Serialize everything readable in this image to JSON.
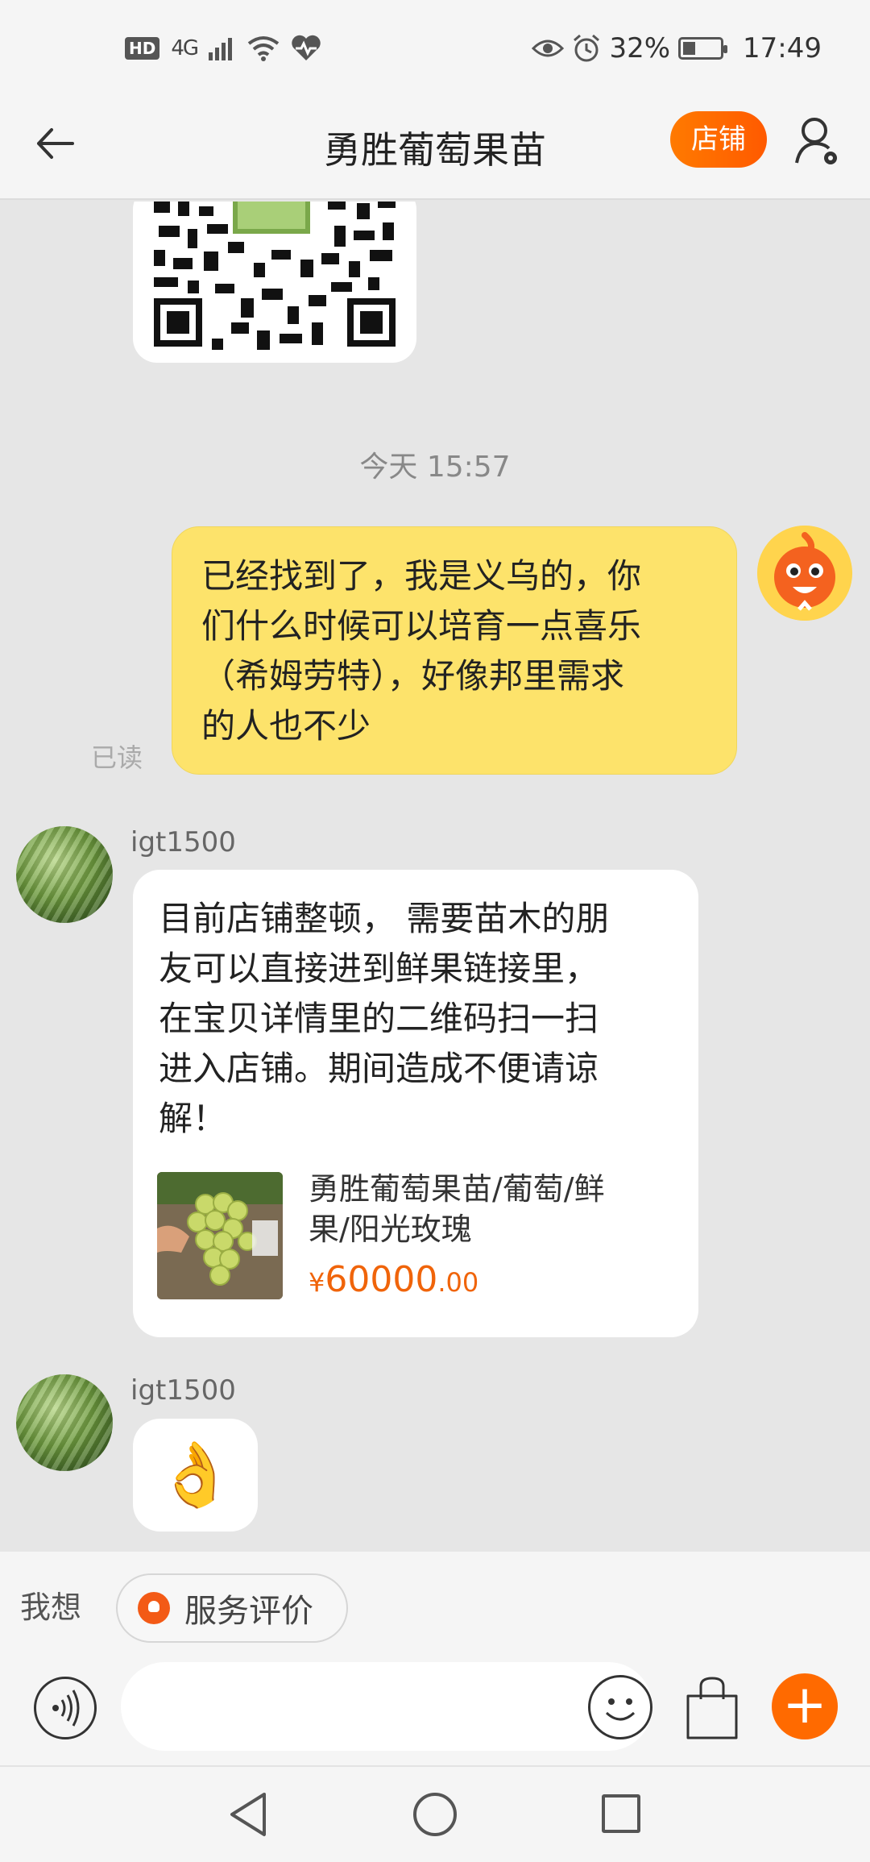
{
  "status_bar": {
    "left_badges": [
      "HD",
      "4G",
      "wifi-icon",
      "health-icon"
    ],
    "hd": "HD",
    "network": "4G",
    "battery": "32%",
    "battery_level": 0.32,
    "time": "17:49"
  },
  "header": {
    "title": "勇胜葡萄果苗",
    "shop_button": "店铺"
  },
  "chat": {
    "timestamp": "今天  15:57",
    "my_message": {
      "lines": [
        "已经找到了，我是义乌的，你",
        "们什么时候可以培育一点喜乐",
        "（希姆劳特），好像邦里需求",
        "的人也不少"
      ],
      "read_status": "已读"
    },
    "reply_1": {
      "sender": "igt1500",
      "lines": [
        "目前店铺整顿， 需要苗木的朋",
        "友可以直接进到鲜果链接里，",
        "在宝贝详情里的二维码扫一扫",
        "进入店铺。期间造成不便请谅",
        "解！"
      ],
      "product": {
        "title_lines": [
          "勇胜葡萄果苗/葡萄/鲜",
          "果/阳光玫瑰"
        ],
        "currency": "¥",
        "price_int": "60000",
        "price_dec": ".00"
      }
    },
    "reply_2": {
      "sender": "igt1500",
      "emoji": "👌"
    }
  },
  "quick_bar": {
    "label": "我想",
    "chip": "服务评价"
  },
  "input_bar": {
    "placeholder": "",
    "plus": "+"
  }
}
